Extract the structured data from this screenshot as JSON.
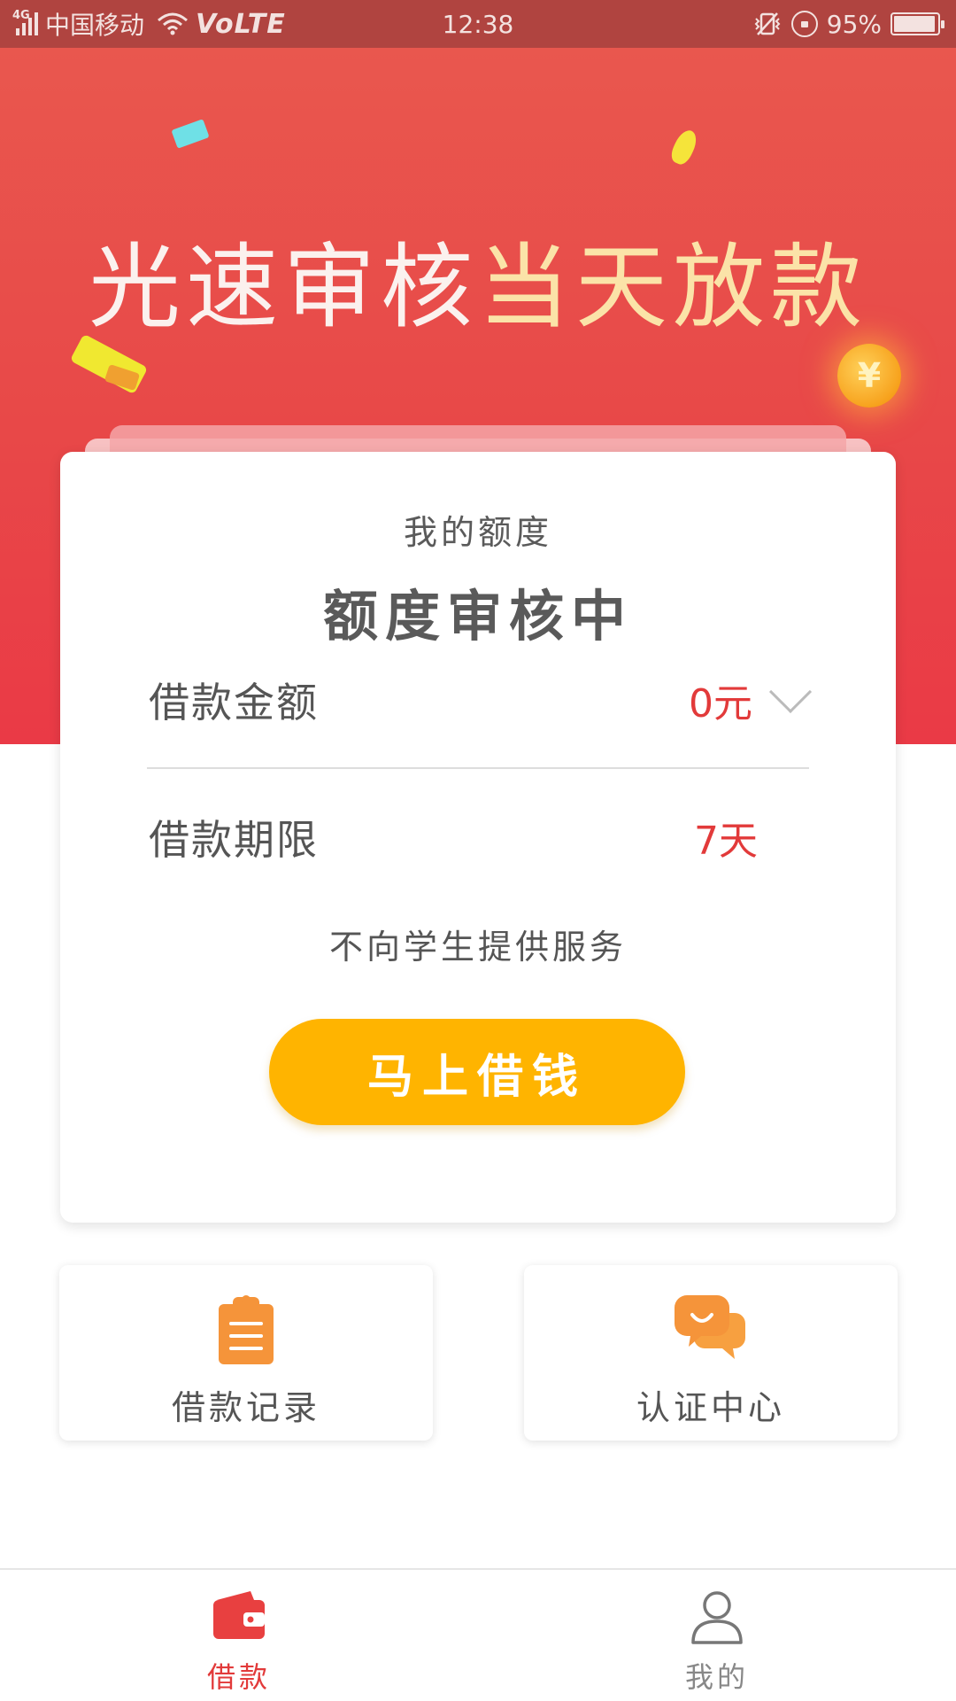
{
  "status_bar": {
    "network": "4G",
    "carrier": "中国移动",
    "volte": "VoLTE",
    "time": "12:38",
    "battery": "95%",
    "icons": [
      "signal-icon",
      "wifi-icon",
      "vibrate-icon",
      "rotation-lock-icon",
      "battery-icon"
    ]
  },
  "banner": {
    "headline_part1": "光速审核",
    "headline_part2": "当天放款",
    "colors": {
      "gradient_top": "#e9574e",
      "gradient_bottom": "#ea3a46",
      "highlight": "#fbe3a8"
    }
  },
  "quota_card": {
    "label": "我的额度",
    "status": "额度审核中",
    "amount": {
      "label": "借款金额",
      "value": "0元"
    },
    "term": {
      "label": "借款期限",
      "value": "7天"
    },
    "notice": "不向学生提供服务",
    "button": "马上借钱",
    "colors": {
      "value": "#e23a3a",
      "button": "#ffb400"
    }
  },
  "tiles": [
    {
      "label": "借款记录",
      "icon": "clipboard-icon"
    },
    {
      "label": "认证中心",
      "icon": "chat-bubble-icon"
    }
  ],
  "bottom_nav": {
    "items": [
      {
        "label": "借款",
        "icon": "wallet-icon",
        "active": true
      },
      {
        "label": "我的",
        "icon": "user-icon",
        "active": false
      }
    ],
    "colors": {
      "active": "#e23a3a",
      "inactive": "#888888"
    }
  }
}
